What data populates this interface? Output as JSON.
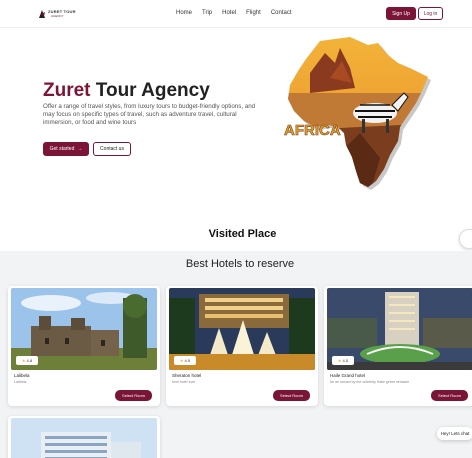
{
  "nav": {
    "logo_title": "ZURET TOUR",
    "logo_sub": "AGENCY",
    "links": [
      "Home",
      "Trip",
      "Hotel",
      "Flight",
      "Contact"
    ],
    "signup_label": "Sign Up",
    "login_label": "Log in"
  },
  "hero": {
    "title_brand": "Zuret",
    "title_rest": " Tour Agency",
    "description": "Offer a range of travel styles, from luxury tours to budget-friendly options, and may focus on specific types of travel, such as adventure travel, cultural immersion, or food and wine tours",
    "start_label": "Get started",
    "contact_label": "Contact us",
    "map_label": "AFRICA"
  },
  "visited": {
    "title": "Visited Place"
  },
  "hotels": {
    "title": "Best Hotels to reserve",
    "cards": [
      {
        "rating": "4.8",
        "name": "Lalibela",
        "sub": "Lalibela",
        "button": "Select Room"
      },
      {
        "rating": "4.5",
        "name": "Sheraton hotel",
        "sub": "best hotel ever",
        "button": "Select Room"
      },
      {
        "rating": "4.5",
        "name": "Haile Grand hotel",
        "sub": "be an owned by the celebrity Haile gebre selassie",
        "button": "Select Room"
      }
    ]
  },
  "chat": {
    "label": "Hey! Lets chat"
  },
  "colors": {
    "accent": "#7a1538"
  }
}
